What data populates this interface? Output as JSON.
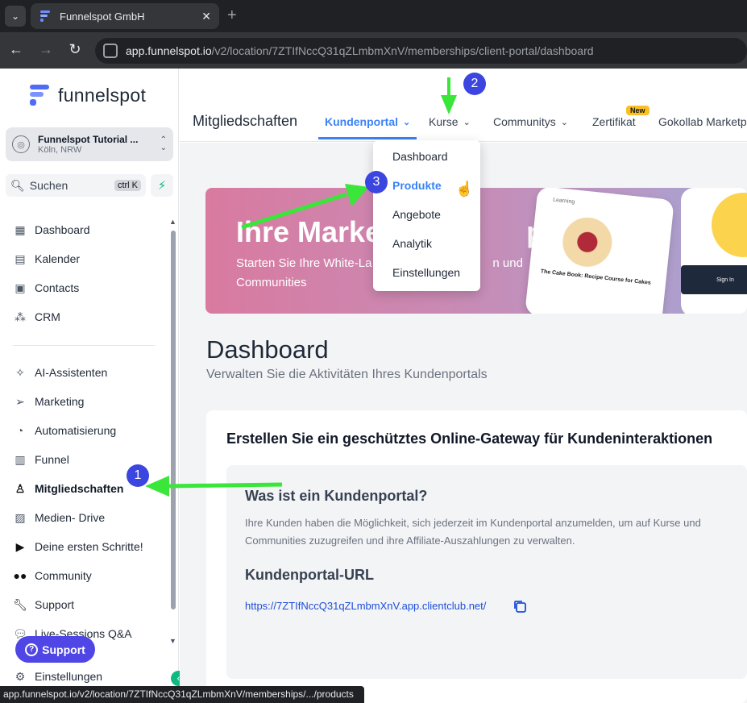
{
  "browser": {
    "tab_title": "Funnelspot GmbH",
    "url_domain": "app.funnelspot.io",
    "url_path": "/v2/location/7ZTIfNccQ31qZLmbmXnV/memberships/client-portal/dashboard",
    "status_url": "app.funnelspot.io/v2/location/7ZTIfNccQ31qZLmbmXnV/memberships/.../products"
  },
  "sidebar": {
    "logo_text": "funnelspot",
    "location_name": "Funnelspot Tutorial ...",
    "location_sub": "Köln, NRW",
    "search_label": "Suchen",
    "search_shortcut": "ctrl K",
    "items_top": [
      {
        "label": "Dashboard",
        "icon": "grid-icon"
      },
      {
        "label": "Kalender",
        "icon": "calendar-icon"
      },
      {
        "label": "Contacts",
        "icon": "contacts-icon"
      },
      {
        "label": "CRM",
        "icon": "crm-icon"
      }
    ],
    "items_bottom": [
      {
        "label": "AI-Assistenten",
        "icon": "sparkle-icon"
      },
      {
        "label": "Marketing",
        "icon": "send-icon"
      },
      {
        "label": "Automatisierung",
        "icon": "automation-icon"
      },
      {
        "label": "Funnel",
        "icon": "funnel-icon"
      },
      {
        "label": "Mitgliedschaften",
        "icon": "award-icon"
      },
      {
        "label": "Medien- Drive",
        "icon": "image-icon"
      },
      {
        "label": "Deine ersten Schritte!",
        "icon": "play-icon"
      },
      {
        "label": "Community",
        "icon": "people-icon"
      },
      {
        "label": "Support",
        "icon": "wrench-icon"
      },
      {
        "label": "Live-Sessions Q&A",
        "icon": "chat-icon"
      },
      {
        "label": "Einstellungen",
        "icon": "gear-icon"
      }
    ],
    "support_button": "Support"
  },
  "topnav": {
    "title": "Mitgliedschaften",
    "tabs": [
      "Kundenportal",
      "Kurse",
      "Communitys",
      "Zertifikat",
      "Gokollab Marketp"
    ],
    "new_badge": "New"
  },
  "dropdown": {
    "items": [
      "Dashboard",
      "Produkte",
      "Angebote",
      "Analytik",
      "Einstellungen"
    ],
    "selected": "Produkte"
  },
  "banner": {
    "headline": "Ihre Marke",
    "headline_end": "pp.",
    "sub_a": "Starten Sie Ihre White-La",
    "sub_b": "n und",
    "sub_c": "Communities",
    "phone_learning": "Learning",
    "phone_course": "The Cake Book: Recipe Course for Cakes",
    "phone_signin": "Sign In"
  },
  "page": {
    "title": "Dashboard",
    "subtitle": "Verwalten Sie die Aktivitäten Ihres Kundenportals",
    "card_title": "Erstellen Sie ein geschütztes Online-Gateway für Kundeninteraktionen",
    "q1": "Was ist ein Kundenportal?",
    "q1_text": "Ihre Kunden haben die Möglichkeit, sich jederzeit im Kundenportal anzumelden, um auf Kurse und Communities zuzugreifen und ihre Affiliate-Auszahlungen zu verwalten.",
    "q2": "Kundenportal-URL",
    "portal_url": "https://7ZTIfNccQ31qZLmbmXnV.app.clientclub.net/"
  },
  "annotations": {
    "badges": [
      "1",
      "2",
      "3"
    ],
    "arrow_color": "#39e639",
    "badge_color": "#3b45e0"
  }
}
